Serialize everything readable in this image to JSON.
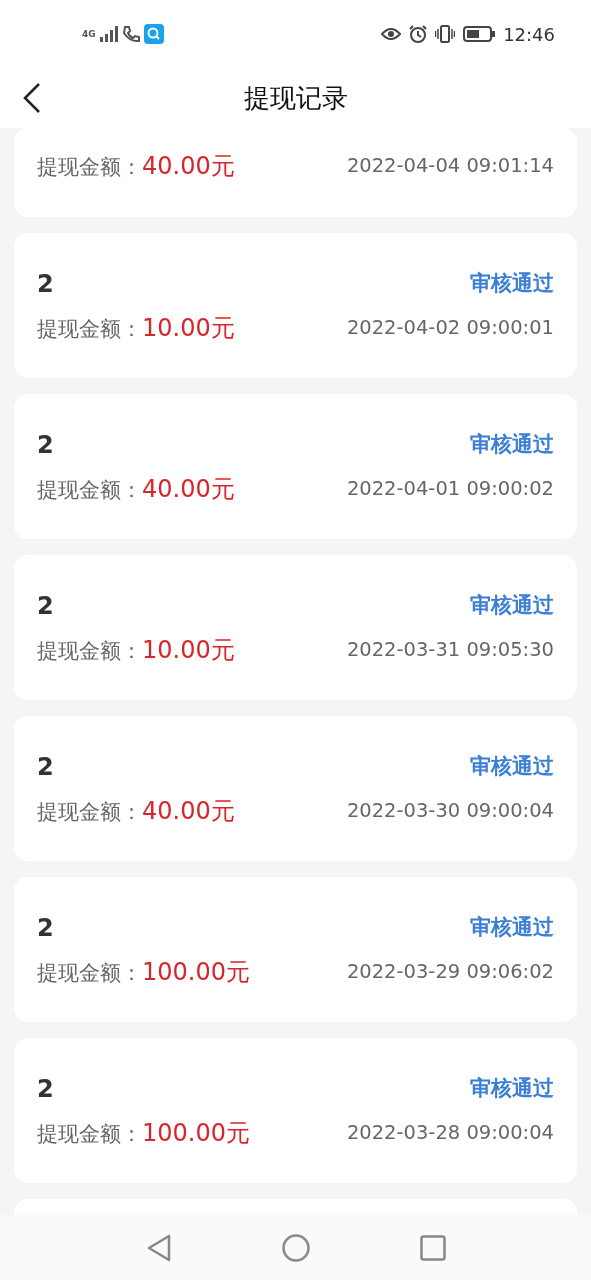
{
  "status_bar": {
    "network_type": "4G",
    "time": "12:46"
  },
  "header": {
    "title": "提现记录"
  },
  "records": [
    {
      "kind": "partial",
      "label": "提现金额：",
      "amount": "40.00元",
      "time": "2022-04-04 09:01:14"
    },
    {
      "kind": "full",
      "name": "2",
      "status": "审核通过",
      "label": "提现金额：",
      "amount": "10.00元",
      "time": "2022-04-02 09:00:01"
    },
    {
      "kind": "full",
      "name": "2",
      "status": "审核通过",
      "label": "提现金额：",
      "amount": "40.00元",
      "time": "2022-04-01 09:00:02"
    },
    {
      "kind": "full",
      "name": "2",
      "status": "审核通过",
      "label": "提现金额：",
      "amount": "10.00元",
      "time": "2022-03-31 09:05:30"
    },
    {
      "kind": "full",
      "name": "2",
      "status": "审核通过",
      "label": "提现金额：",
      "amount": "40.00元",
      "time": "2022-03-30 09:00:04"
    },
    {
      "kind": "full",
      "name": "2",
      "status": "审核通过",
      "label": "提现金额：",
      "amount": "100.00元",
      "time": "2022-03-29 09:06:02"
    },
    {
      "kind": "full",
      "name": "2",
      "status": "审核通过",
      "label": "提现金额：",
      "amount": "100.00元",
      "time": "2022-03-28 09:00:04"
    },
    {
      "kind": "empty"
    }
  ]
}
